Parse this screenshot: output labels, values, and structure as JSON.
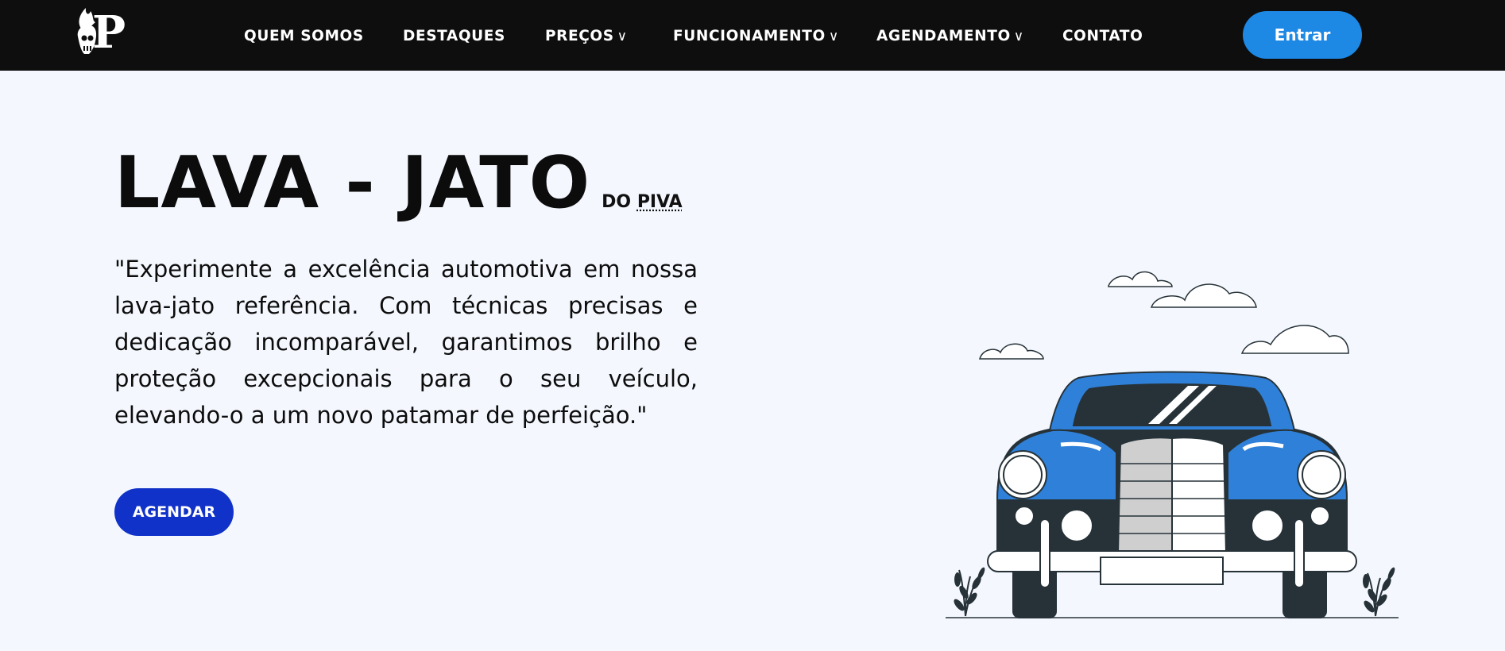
{
  "brand": {
    "logo_letter": "P"
  },
  "nav": {
    "items": [
      {
        "label": "QUEM SOMOS",
        "has_dropdown": false
      },
      {
        "label": "DESTAQUES",
        "has_dropdown": false
      },
      {
        "label": "PREÇOS",
        "has_dropdown": true
      },
      {
        "label": "FUNCIONAMENTO",
        "has_dropdown": true
      },
      {
        "label": "AGENDAMENTO",
        "has_dropdown": true
      },
      {
        "label": "CONTATO",
        "has_dropdown": false
      }
    ],
    "dropdown_glyph": "∨",
    "enter_label": "Entrar"
  },
  "hero": {
    "title": "LAVA - JATO",
    "subtitle_prefix": "DO",
    "subtitle_name": "PIVA",
    "description": "\"Experimente a excelência automotiva em nossa lava-jato referência. Com técnicas precisas e dedicação incomparável, garantimos brilho e proteção excepcionais para o seu veículo, elevando-o a um novo patamar de perfeição.\"",
    "cta_label": "AGENDAR"
  },
  "colors": {
    "navbar_bg": "#0e0e0e",
    "page_bg": "#f4f8fe",
    "enter_button": "#1e88e5",
    "cta_button": "#1032c8",
    "car_accent": "#2f80d8",
    "car_dark": "#263238"
  },
  "icons": {
    "logo": "flame-p-logo-icon",
    "dropdown": "chevron-down-icon",
    "illustration": "vintage-car-illustration"
  }
}
